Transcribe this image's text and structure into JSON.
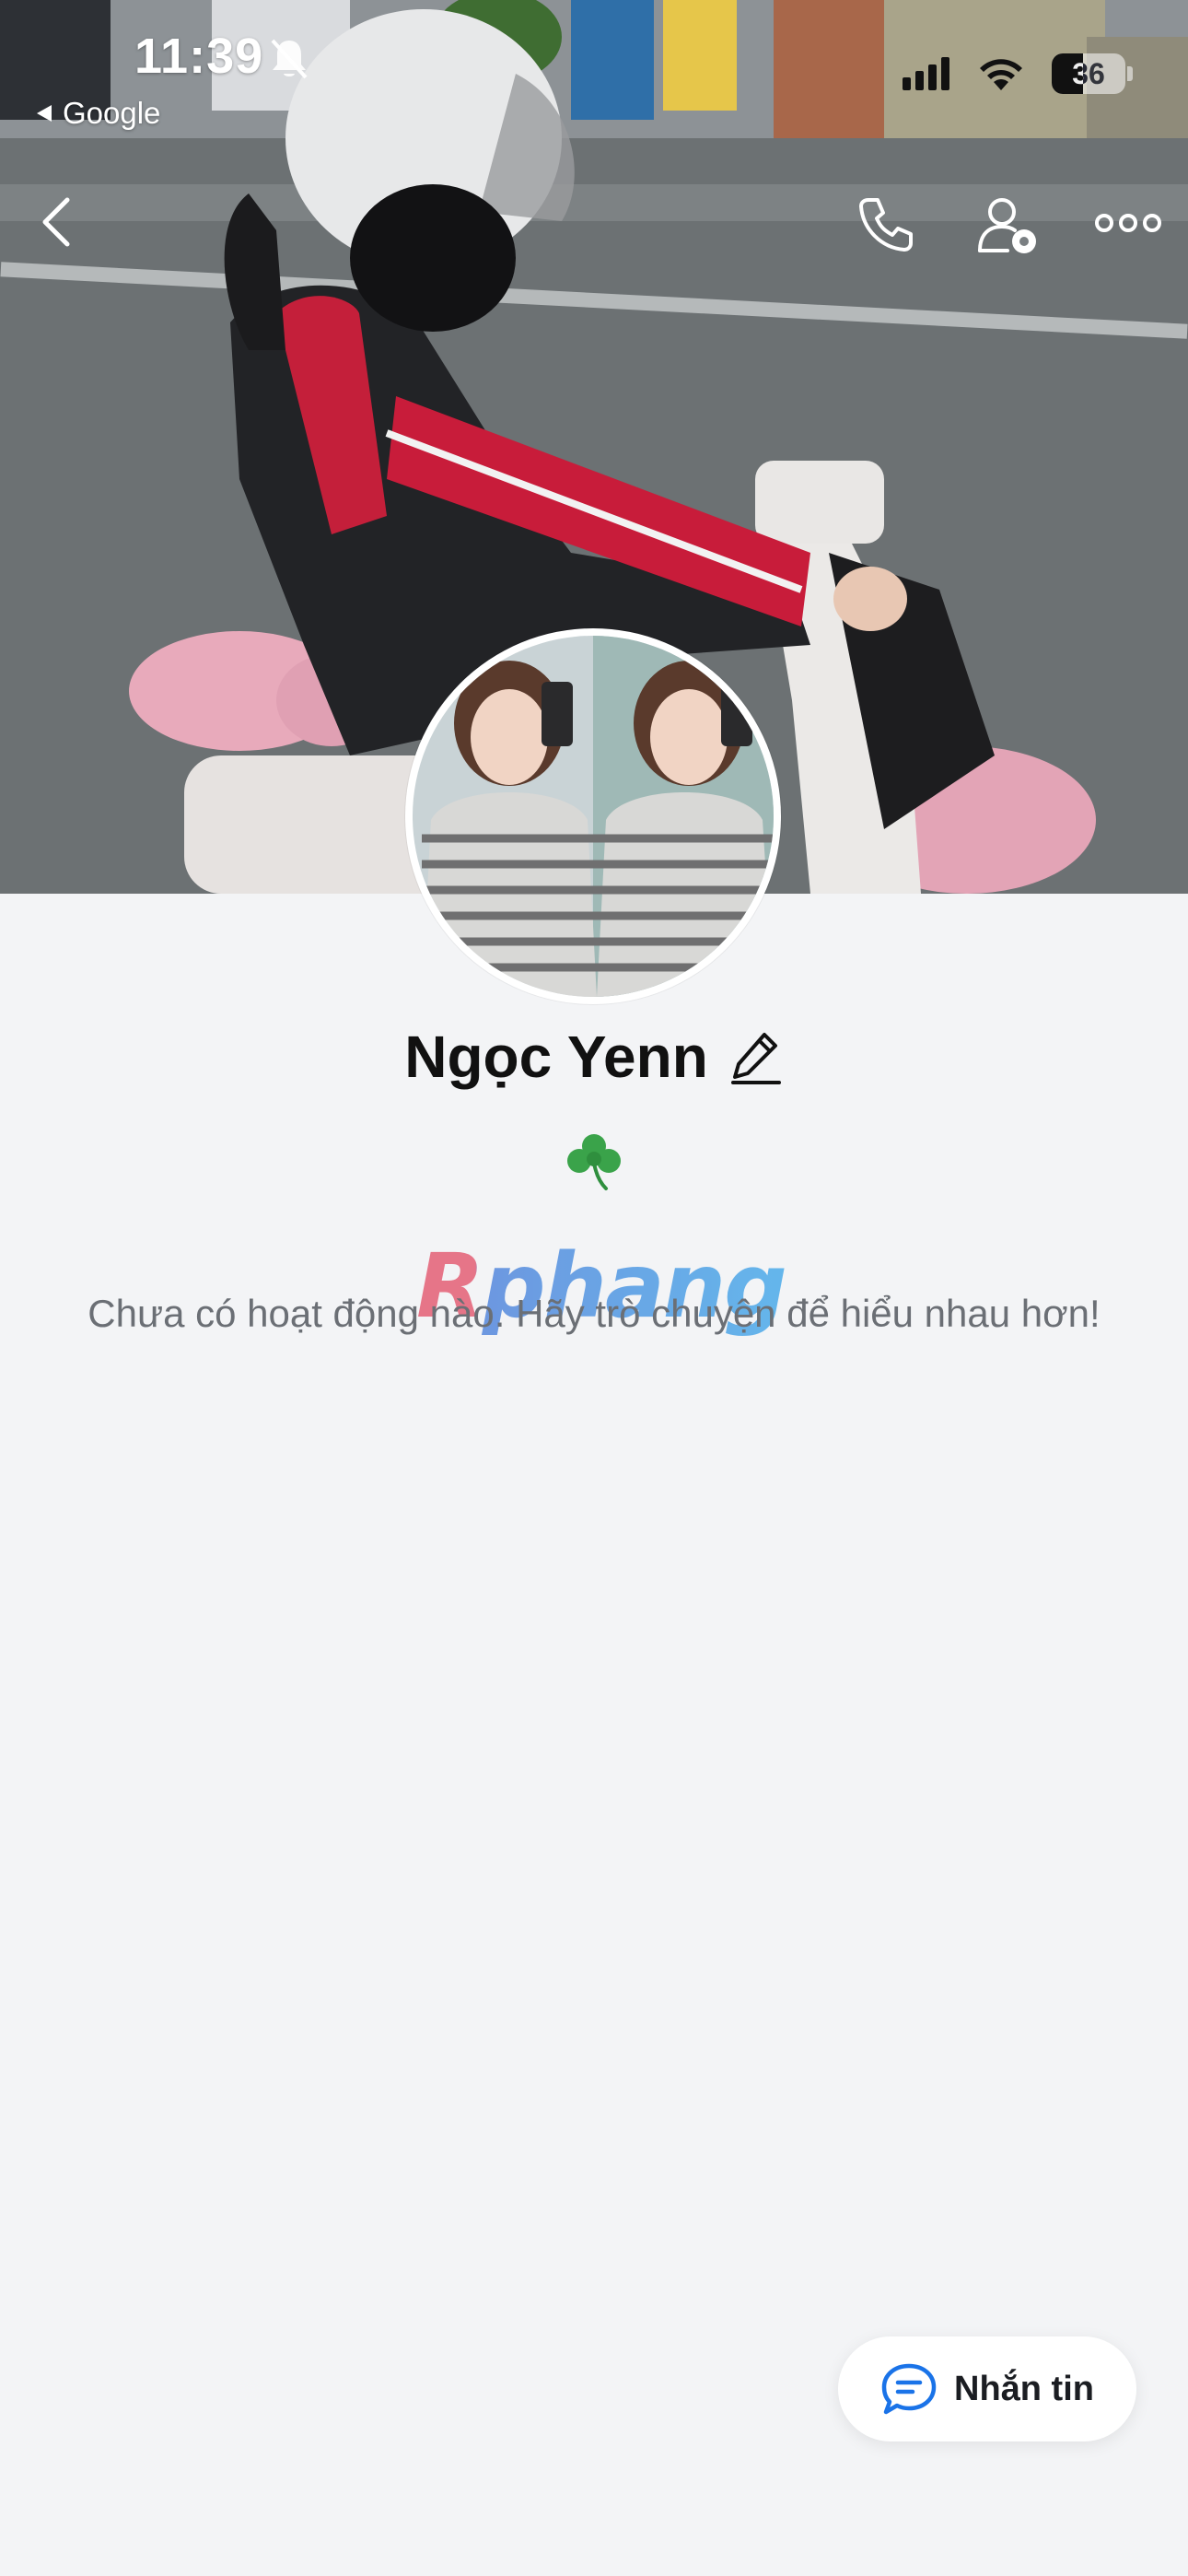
{
  "status_bar": {
    "time": "11:39",
    "back_to_app": "Google",
    "battery_level": "36",
    "bell_muted": true
  },
  "header": {
    "back_icon": "chevron-left-icon",
    "call_icon": "phone-icon",
    "settings_icon": "user-settings-icon",
    "more_icon": "ellipsis-icon"
  },
  "profile": {
    "name": "Ngọc Yenn",
    "bio_emoji": "☘️",
    "edit_icon": "pencil-icon"
  },
  "watermark": "Rphang",
  "feed": {
    "empty_message": "Chưa có hoạt động nào. Hãy trò chuyện để hiểu nhau hơn!"
  },
  "message_button": {
    "label": "Nhắn tin",
    "icon": "chat-bubble-icon"
  },
  "colors": {
    "background": "#f3f4f6",
    "accent_blue": "#1a73e8",
    "text_primary": "#111111",
    "text_secondary": "#6b6f75"
  }
}
